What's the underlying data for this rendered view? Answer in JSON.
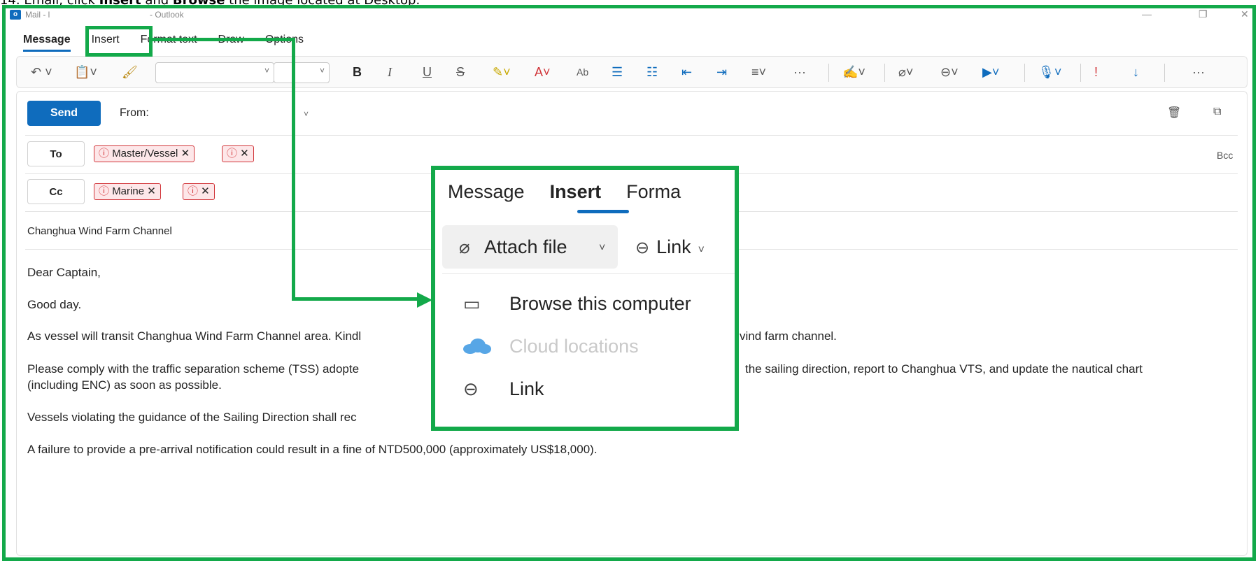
{
  "caption": {
    "prefix": "14. Email, click ",
    "bold1": "Insert",
    "middle": " and ",
    "bold2": "Browse",
    "suffix": " the image located at Desktop."
  },
  "window": {
    "title_left": "Mail - l",
    "title_right": "- Outlook",
    "minimize": "—",
    "restore": "❐",
    "close": "✕"
  },
  "ribbon_tabs": [
    "Message",
    "Insert",
    "Format text",
    "Draw",
    "Options"
  ],
  "toolbar": {
    "undo_icon": "undo-icon",
    "bold": "B",
    "italic": "I",
    "underline": "U",
    "strike": "S",
    "more": "···"
  },
  "compose": {
    "send_label": "Send",
    "from_label": "From:",
    "to_label": "To",
    "cc_label": "Cc",
    "bcc_label": "Bcc",
    "to_chips": [
      "Master/Vessel",
      ""
    ],
    "cc_chips": [
      "Marine",
      ""
    ],
    "subject": "Changhua Wind Farm Channel",
    "body": [
      "Dear Captain,",
      "Good day.",
      "As vessel will transit Changhua Wind Farm Channel area. Kindl",
      "Please comply with the traffic separation scheme (TSS) adopte",
      "(including ENC) as soon as possible.",
      "Vessels violating the guidance of the Sailing Direction shall rec",
      "A failure to provide a pre-arrival notification could result in a fine of NTD500,000 (approximately US$18,000)."
    ],
    "body_right": {
      "line3_tail": "vind farm channel.",
      "line4_tail": "the sailing direction, report to Changhua VTS, and update the nautical chart"
    }
  },
  "inset": {
    "tabs": [
      "Message",
      "Insert",
      "Forma"
    ],
    "attach_label": "Attach file",
    "link_label": "Link",
    "menu": [
      {
        "label": "Browse this computer",
        "icon": "laptop-icon",
        "enabled": true
      },
      {
        "label": "Cloud locations",
        "icon": "cloud-icon",
        "enabled": false
      },
      {
        "label": "Link",
        "icon": "link-icon",
        "enabled": true
      }
    ]
  },
  "colors": {
    "annotation_green": "#13a94a",
    "accent_blue": "#0f6cbd",
    "warning_red": "#d13438"
  }
}
